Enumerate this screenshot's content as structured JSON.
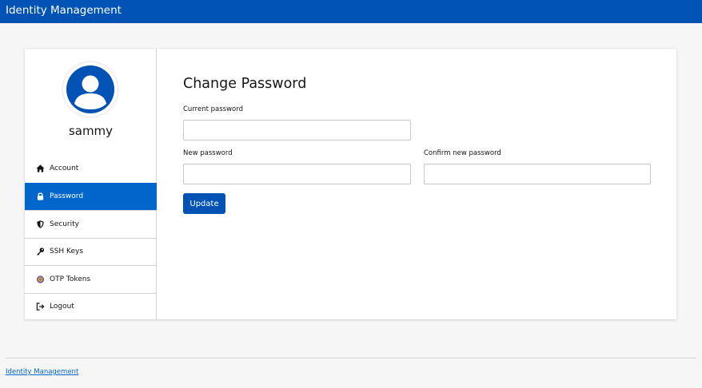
{
  "app": {
    "title": "Identity Management"
  },
  "user": {
    "name": "sammy"
  },
  "sidebar": {
    "items": [
      {
        "label": "Account",
        "icon": "home-icon",
        "active": false
      },
      {
        "label": "Password",
        "icon": "lock-icon",
        "active": true
      },
      {
        "label": "Security",
        "icon": "shield-icon",
        "active": false
      },
      {
        "label": "SSH Keys",
        "icon": "key-icon",
        "active": false
      },
      {
        "label": "OTP Tokens",
        "icon": "otp-token-icon",
        "active": false
      },
      {
        "label": "Logout",
        "icon": "logout-icon",
        "active": false
      }
    ]
  },
  "form": {
    "title": "Change Password",
    "current_password": {
      "label": "Current password",
      "value": ""
    },
    "new_password": {
      "label": "New password",
      "value": ""
    },
    "confirm_password": {
      "label": "Confirm new password",
      "value": ""
    },
    "submit_label": "Update"
  },
  "footer": {
    "link": "Identity Management"
  },
  "colors": {
    "topbar": "#0052b4",
    "accent": "#0066cc",
    "button": "#0052b4",
    "background": "#f6f6f6"
  }
}
